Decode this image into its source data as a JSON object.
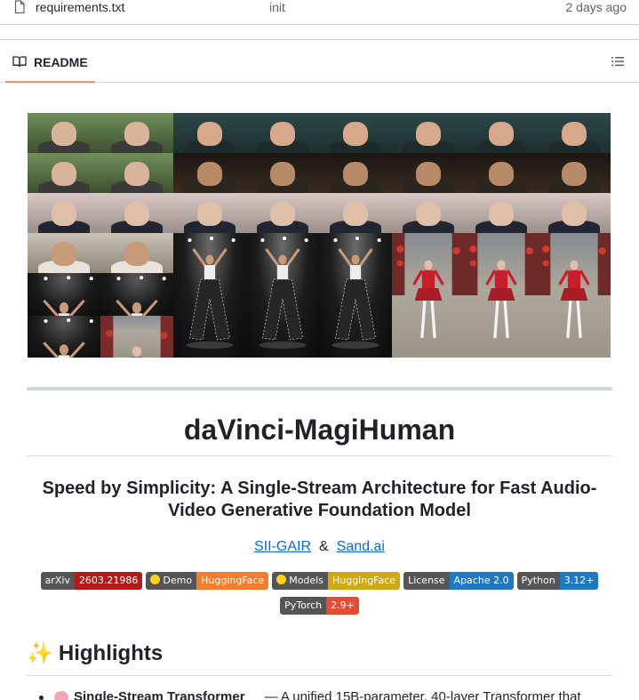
{
  "file_row": {
    "name": "requirements.txt",
    "commit": "init",
    "age": "2 days ago",
    "icon": "file-icon"
  },
  "readme": {
    "tab_label": "README",
    "icon": "book-icon",
    "toc_icon": "list-unordered-icon",
    "accent": "#fd8c73"
  },
  "title": "daVinci-MagiHuman",
  "subtitle": "Speed by Simplicity: A Single-Stream Architecture for Fast Audio-Video Generative Foundation Model",
  "links": {
    "left": "SII-GAIR",
    "amp": "&",
    "right": "Sand.ai"
  },
  "badges": [
    {
      "left": "arXiv",
      "right": "2603.21986",
      "color": "#b31b1b",
      "emoji": false
    },
    {
      "left": "Demo",
      "right": "HuggingFace",
      "color": "#f47c2c",
      "emoji": true
    },
    {
      "left": "Models",
      "right": "HuggingFace",
      "color": "#cfa814",
      "emoji": true
    },
    {
      "left": "License",
      "right": "Apache 2.0",
      "color": "#1f78c1",
      "emoji": false
    },
    {
      "left": "Python",
      "right": "3.12+",
      "color": "#1d79c2",
      "emoji": false
    },
    {
      "left": "PyTorch",
      "right": "2.9+",
      "color": "#e34c35",
      "emoji": false
    }
  ],
  "highlights": {
    "heading": "Highlights",
    "spark_icon": "sparkles-icon",
    "first_item": {
      "icon": "brain-icon",
      "bold": "Single-Stream Transformer",
      "separator": "—",
      "text": "A unified 15B-parameter, 40-layer Transformer that"
    }
  }
}
